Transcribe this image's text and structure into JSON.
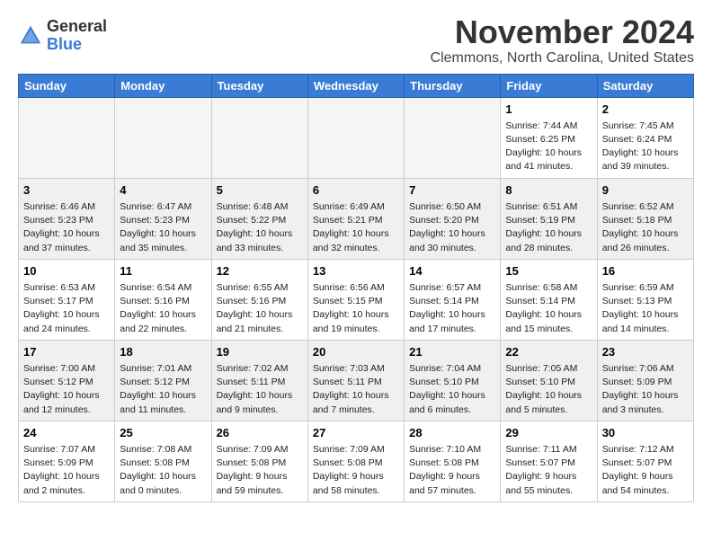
{
  "header": {
    "logo_general": "General",
    "logo_blue": "Blue",
    "month_title": "November 2024",
    "location": "Clemmons, North Carolina, United States"
  },
  "weekdays": [
    "Sunday",
    "Monday",
    "Tuesday",
    "Wednesday",
    "Thursday",
    "Friday",
    "Saturday"
  ],
  "weeks": [
    [
      {
        "day": "",
        "empty": true
      },
      {
        "day": "",
        "empty": true
      },
      {
        "day": "",
        "empty": true
      },
      {
        "day": "",
        "empty": true
      },
      {
        "day": "",
        "empty": true
      },
      {
        "day": "1",
        "info": "Sunrise: 7:44 AM\nSunset: 6:25 PM\nDaylight: 10 hours\nand 41 minutes."
      },
      {
        "day": "2",
        "info": "Sunrise: 7:45 AM\nSunset: 6:24 PM\nDaylight: 10 hours\nand 39 minutes."
      }
    ],
    [
      {
        "day": "3",
        "info": "Sunrise: 6:46 AM\nSunset: 5:23 PM\nDaylight: 10 hours\nand 37 minutes."
      },
      {
        "day": "4",
        "info": "Sunrise: 6:47 AM\nSunset: 5:23 PM\nDaylight: 10 hours\nand 35 minutes."
      },
      {
        "day": "5",
        "info": "Sunrise: 6:48 AM\nSunset: 5:22 PM\nDaylight: 10 hours\nand 33 minutes."
      },
      {
        "day": "6",
        "info": "Sunrise: 6:49 AM\nSunset: 5:21 PM\nDaylight: 10 hours\nand 32 minutes."
      },
      {
        "day": "7",
        "info": "Sunrise: 6:50 AM\nSunset: 5:20 PM\nDaylight: 10 hours\nand 30 minutes."
      },
      {
        "day": "8",
        "info": "Sunrise: 6:51 AM\nSunset: 5:19 PM\nDaylight: 10 hours\nand 28 minutes."
      },
      {
        "day": "9",
        "info": "Sunrise: 6:52 AM\nSunset: 5:18 PM\nDaylight: 10 hours\nand 26 minutes."
      }
    ],
    [
      {
        "day": "10",
        "info": "Sunrise: 6:53 AM\nSunset: 5:17 PM\nDaylight: 10 hours\nand 24 minutes."
      },
      {
        "day": "11",
        "info": "Sunrise: 6:54 AM\nSunset: 5:16 PM\nDaylight: 10 hours\nand 22 minutes."
      },
      {
        "day": "12",
        "info": "Sunrise: 6:55 AM\nSunset: 5:16 PM\nDaylight: 10 hours\nand 21 minutes."
      },
      {
        "day": "13",
        "info": "Sunrise: 6:56 AM\nSunset: 5:15 PM\nDaylight: 10 hours\nand 19 minutes."
      },
      {
        "day": "14",
        "info": "Sunrise: 6:57 AM\nSunset: 5:14 PM\nDaylight: 10 hours\nand 17 minutes."
      },
      {
        "day": "15",
        "info": "Sunrise: 6:58 AM\nSunset: 5:14 PM\nDaylight: 10 hours\nand 15 minutes."
      },
      {
        "day": "16",
        "info": "Sunrise: 6:59 AM\nSunset: 5:13 PM\nDaylight: 10 hours\nand 14 minutes."
      }
    ],
    [
      {
        "day": "17",
        "info": "Sunrise: 7:00 AM\nSunset: 5:12 PM\nDaylight: 10 hours\nand 12 minutes."
      },
      {
        "day": "18",
        "info": "Sunrise: 7:01 AM\nSunset: 5:12 PM\nDaylight: 10 hours\nand 11 minutes."
      },
      {
        "day": "19",
        "info": "Sunrise: 7:02 AM\nSunset: 5:11 PM\nDaylight: 10 hours\nand 9 minutes."
      },
      {
        "day": "20",
        "info": "Sunrise: 7:03 AM\nSunset: 5:11 PM\nDaylight: 10 hours\nand 7 minutes."
      },
      {
        "day": "21",
        "info": "Sunrise: 7:04 AM\nSunset: 5:10 PM\nDaylight: 10 hours\nand 6 minutes."
      },
      {
        "day": "22",
        "info": "Sunrise: 7:05 AM\nSunset: 5:10 PM\nDaylight: 10 hours\nand 5 minutes."
      },
      {
        "day": "23",
        "info": "Sunrise: 7:06 AM\nSunset: 5:09 PM\nDaylight: 10 hours\nand 3 minutes."
      }
    ],
    [
      {
        "day": "24",
        "info": "Sunrise: 7:07 AM\nSunset: 5:09 PM\nDaylight: 10 hours\nand 2 minutes."
      },
      {
        "day": "25",
        "info": "Sunrise: 7:08 AM\nSunset: 5:08 PM\nDaylight: 10 hours\nand 0 minutes."
      },
      {
        "day": "26",
        "info": "Sunrise: 7:09 AM\nSunset: 5:08 PM\nDaylight: 9 hours\nand 59 minutes."
      },
      {
        "day": "27",
        "info": "Sunrise: 7:09 AM\nSunset: 5:08 PM\nDaylight: 9 hours\nand 58 minutes."
      },
      {
        "day": "28",
        "info": "Sunrise: 7:10 AM\nSunset: 5:08 PM\nDaylight: 9 hours\nand 57 minutes."
      },
      {
        "day": "29",
        "info": "Sunrise: 7:11 AM\nSunset: 5:07 PM\nDaylight: 9 hours\nand 55 minutes."
      },
      {
        "day": "30",
        "info": "Sunrise: 7:12 AM\nSunset: 5:07 PM\nDaylight: 9 hours\nand 54 minutes."
      }
    ]
  ]
}
